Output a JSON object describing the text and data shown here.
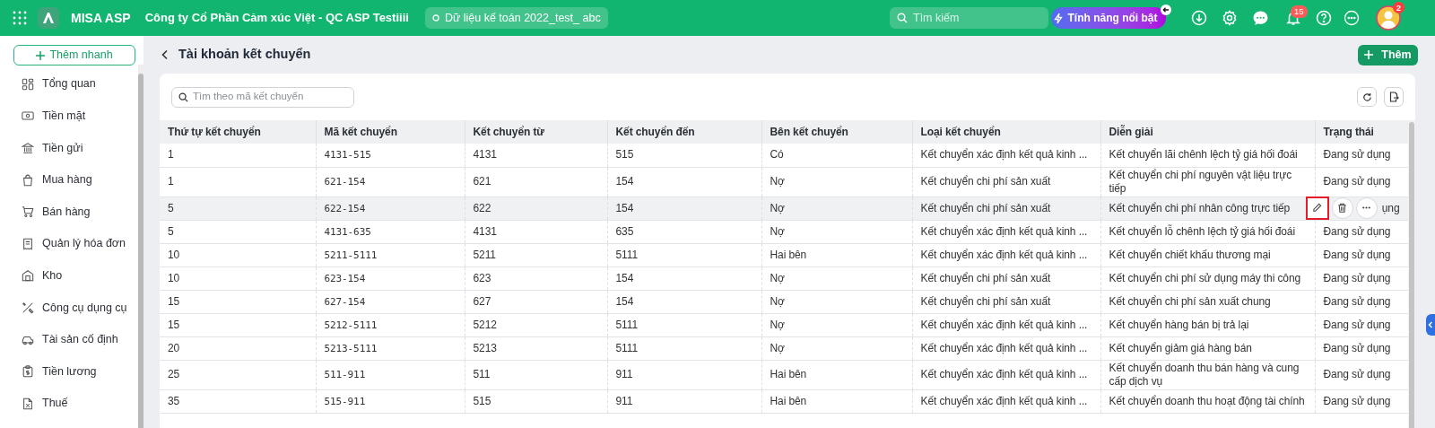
{
  "top_bar": {
    "app_name": "MISA ASP",
    "company": "Công ty Cổ Phần Cảm xúc Việt - QC ASP Testiiii",
    "dataset": "Dữ liệu kế toán 2022_test_ abc",
    "search": {
      "placeholder": "Tìm kiếm"
    },
    "featured_button": "Tính năng nổi bật",
    "notification_count": "15",
    "avatar_badge": "2"
  },
  "sidebar": {
    "quick_add": "Thêm nhanh",
    "items": [
      {
        "label": "Tổng quan"
      },
      {
        "label": "Tiền mặt"
      },
      {
        "label": "Tiền gửi"
      },
      {
        "label": "Mua hàng"
      },
      {
        "label": "Bán hàng"
      },
      {
        "label": "Quản lý hóa đơn"
      },
      {
        "label": "Kho"
      },
      {
        "label": "Công cụ dụng cụ"
      },
      {
        "label": "Tài sản cố định"
      },
      {
        "label": "Tiền lương"
      },
      {
        "label": "Thuế"
      }
    ]
  },
  "page": {
    "title": "Tài khoản kết chuyển",
    "add_button": "Thêm",
    "search": {
      "placeholder": "Tìm theo mã kết chuyển"
    }
  },
  "table": {
    "columns": [
      "Thứ tự kết chuyển",
      "Mã kết chuyển",
      "Kết chuyển từ",
      "Kết chuyển đến",
      "Bên kết chuyển",
      "Loại kết chuyển",
      "Diễn giải",
      "Trạng thái"
    ],
    "rows": [
      {
        "hovered": false,
        "cells": [
          "1",
          "4131-515",
          "4131",
          "515",
          "Có",
          "Kết chuyển xác định kết quả kinh ...",
          "Kết chuyển lãi chênh lệch tỷ giá hối đoái",
          "Đang sử dụng"
        ]
      },
      {
        "hovered": false,
        "cells": [
          "1",
          "621-154",
          "621",
          "154",
          "Nợ",
          "Kết chuyển chi phí sản xuất",
          "Kết chuyển chi phí nguyên vật liệu trực tiếp",
          "Đang sử dụng"
        ]
      },
      {
        "hovered": true,
        "cells": [
          "5",
          "622-154",
          "622",
          "154",
          "Nợ",
          "Kết chuyển chi phí sản xuất",
          "Kết chuyển chi phí nhân công trực tiếp",
          "ụng"
        ],
        "actions": [
          {
            "kind": "edit",
            "highlighted": true
          },
          {
            "kind": "delete",
            "highlighted": false
          },
          {
            "kind": "more",
            "highlighted": false
          }
        ]
      },
      {
        "hovered": false,
        "cells": [
          "5",
          "4131-635",
          "4131",
          "635",
          "Nợ",
          "Kết chuyển xác định kết quả kinh ...",
          "Kết chuyển lỗ chênh lệch tỷ giá hối đoái",
          "Đang sử dụng"
        ]
      },
      {
        "hovered": false,
        "cells": [
          "10",
          "5211-5111",
          "5211",
          "5111",
          "Hai bên",
          "Kết chuyển xác định kết quả kinh ...",
          "Kết chuyển chiết khấu thương mại",
          "Đang sử dụng"
        ]
      },
      {
        "hovered": false,
        "cells": [
          "10",
          "623-154",
          "623",
          "154",
          "Nợ",
          "Kết chuyển chi phí sản xuất",
          "Kết chuyển chi phí sử dụng máy thi công",
          "Đang sử dụng"
        ]
      },
      {
        "hovered": false,
        "cells": [
          "15",
          "627-154",
          "627",
          "154",
          "Nợ",
          "Kết chuyển chi phí sản xuất",
          "Kết chuyển chi phí sản xuất chung",
          "Đang sử dụng"
        ]
      },
      {
        "hovered": false,
        "cells": [
          "15",
          "5212-5111",
          "5212",
          "5111",
          "Nợ",
          "Kết chuyển xác định kết quả kinh ...",
          "Kết chuyển hàng bán bị trả lại",
          "Đang sử dụng"
        ]
      },
      {
        "hovered": false,
        "cells": [
          "20",
          "5213-5111",
          "5213",
          "5111",
          "Nợ",
          "Kết chuyển xác định kết quả kinh ...",
          "Kết chuyển giảm giá hàng bán",
          "Đang sử dụng"
        ]
      },
      {
        "hovered": false,
        "cells": [
          "25",
          "511-911",
          "511",
          "911",
          "Hai bên",
          "Kết chuyển xác định kết quả kinh ...",
          "Kết chuyển doanh thu bán hàng và cung cấp dịch vụ",
          "Đang sử dụng"
        ]
      },
      {
        "hovered": false,
        "cells": [
          "35",
          "515-911",
          "515",
          "911",
          "Hai bên",
          "Kết chuyển xác định kết quả kinh ...",
          "Kết chuyển doanh thu hoạt động tài chính",
          "Đang sử dụng"
        ]
      }
    ]
  }
}
